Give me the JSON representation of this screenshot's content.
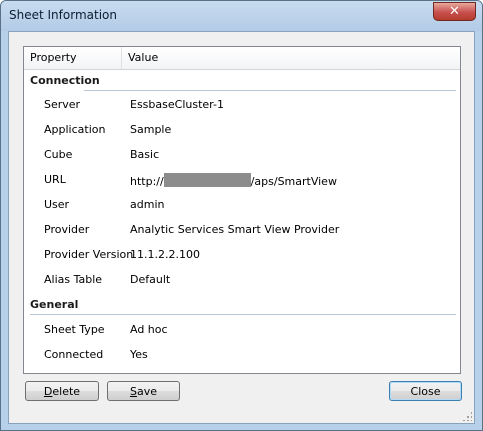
{
  "window": {
    "title": "Sheet Information",
    "close_glyph": "✕"
  },
  "table": {
    "columns": {
      "property": "Property",
      "value": "Value"
    },
    "sections": [
      {
        "name": "Connection",
        "rows": [
          {
            "property": "Server",
            "value": "EssbaseCluster-1"
          },
          {
            "property": "Application",
            "value": "Sample"
          },
          {
            "property": "Cube",
            "value": "Basic"
          },
          {
            "property": "URL",
            "value_prefix": "http://",
            "value_suffix": "/aps/SmartView"
          },
          {
            "property": "User",
            "value": "admin"
          },
          {
            "property": "Provider",
            "value": "Analytic Services Smart View Provider"
          },
          {
            "property": "Provider Version",
            "value": "11.1.2.2.100"
          },
          {
            "property": "Alias Table",
            "value": "Default"
          }
        ]
      },
      {
        "name": "General",
        "rows": [
          {
            "property": "Sheet Type",
            "value": "Ad hoc"
          },
          {
            "property": "Connected",
            "value": "Yes"
          }
        ]
      }
    ]
  },
  "buttons": {
    "delete": {
      "mnemonic": "D",
      "rest": "elete"
    },
    "save": {
      "mnemonic": "S",
      "rest": "ave"
    },
    "close": "Close"
  }
}
